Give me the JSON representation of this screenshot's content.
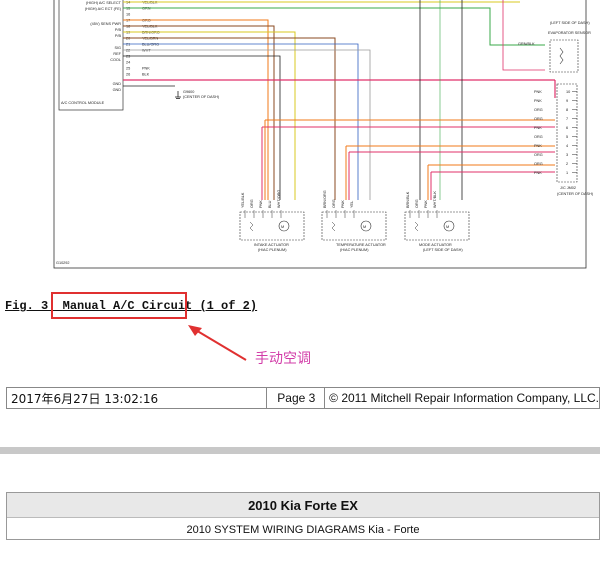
{
  "diagram": {
    "module_labels": [
      "(HIGH) A/C SELECT",
      "(HIGH) A/C ECT (FE)",
      "(45V) SENS PWR",
      "P/B",
      "P/B",
      "SIG",
      "REF",
      "COOL",
      "GND",
      "GND"
    ],
    "module_name": "A/C CONTROL MODULE",
    "pin_numbers": [
      "14",
      "15",
      "16",
      "17",
      "18",
      "19",
      "20",
      "21",
      "22",
      "23",
      "24",
      "25",
      "26"
    ],
    "wire_colors": [
      "YEL/BLK",
      "GRN",
      "",
      "ORG",
      "YEL/BLK",
      "BRN/ORG",
      "YEL/BRN",
      "BLU/ORG",
      "WHT",
      "",
      "",
      "PNK",
      "BLK"
    ],
    "ground_label": "G9600",
    "ground_location": "(CENTER OF DASH)",
    "evap_sensor_label": "EVAPORATOR SENSOR",
    "evap_sensor_location": "(LEFT SIDE OF DASH)",
    "evap_wire": "GRN/BLK",
    "jc_label": "J/C JM02",
    "jc_location": "(CENTER OF DASH)",
    "jc_wires": [
      "PNK",
      "PNK",
      "ORG",
      "ORG",
      "PNK",
      "ORG",
      "PNK",
      "ORG",
      "ORG",
      "PNK"
    ],
    "jc_pins": [
      "10",
      "9",
      "8",
      "7",
      "6",
      "5",
      "4",
      "3",
      "2",
      "1"
    ],
    "actuators": [
      {
        "name": "INTAKE ACTUATOR",
        "location": "(H/AC PLENUM)",
        "wires": [
          "YEL/BLK",
          "ORG",
          "PNK",
          "BLU",
          "WHT/ORG"
        ]
      },
      {
        "name": "TEMPERATURE ACTUATOR",
        "location": "(H/AC PLENUM)",
        "wires": [
          "BRN/ORG",
          "ORG",
          "PNK",
          "YEL"
        ]
      },
      {
        "name": "MODE ACTUATOR",
        "location": "(LEFT SIDE OF DASH)",
        "wires": [
          "BRN/BLK",
          "ORG",
          "PNK",
          "WHT/BLK"
        ]
      }
    ],
    "diagram_code": "G10292"
  },
  "caption": {
    "prefix": "Fig. 3:",
    "title": "Manual A/C Circuit",
    "suffix": "(1 of 2)"
  },
  "annotation": {
    "text": "手动空调",
    "color": "#d23ca8",
    "box_color": "#e03030"
  },
  "footer": {
    "date": "2017年6月27日  13:02:16",
    "page": "Page 3",
    "copyright": "© 2011 Mitchell Repair Information Company, LLC."
  },
  "document_header": {
    "title": "2010 Kia Forte EX",
    "subtitle": "2010 SYSTEM WIRING DIAGRAMS Kia - Forte"
  },
  "wire_palette": {
    "orange": "#f07a1a",
    "pink": "#e0306a",
    "black": "#222222",
    "yellow": "#d8c820",
    "green": "#3aa84a",
    "brown": "#8a4a20",
    "blue": "#3060c0",
    "gray": "#9a9a9a"
  }
}
